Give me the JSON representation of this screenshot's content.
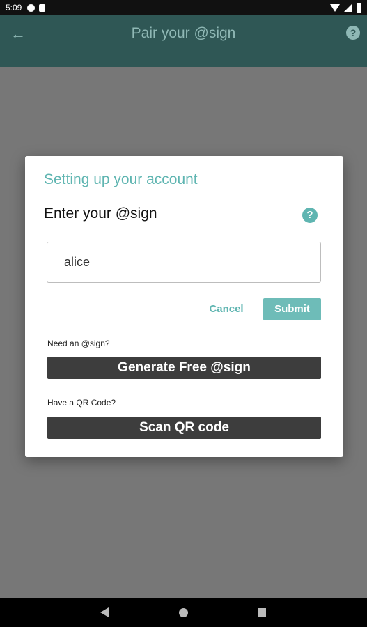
{
  "status_bar": {
    "time": "5:09"
  },
  "app_bar": {
    "title": "Pair your @sign",
    "back_icon": "arrow-left-icon",
    "help_icon": "help-circle-icon"
  },
  "dialog": {
    "title": "Setting up your account",
    "subtitle": "Enter your @sign",
    "input_value": "alice",
    "cancel_label": "Cancel",
    "submit_label": "Submit",
    "need_hint": "Need an @sign?",
    "generate_label": "Generate Free @sign",
    "qr_hint": "Have a QR Code?",
    "scan_label": "Scan QR code"
  },
  "colors": {
    "accent": "#5fb5b1",
    "app_bar": "#2f5755",
    "dark_button": "#3d3d3d",
    "scrim": "#777777"
  }
}
